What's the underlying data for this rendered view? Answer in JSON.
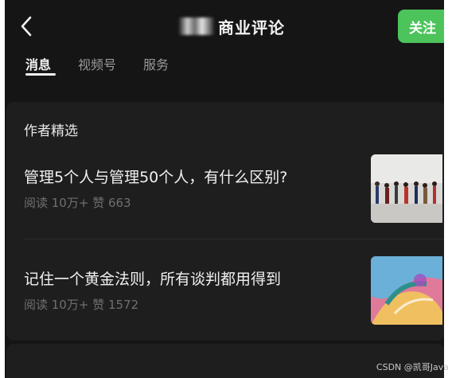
{
  "header": {
    "back_icon": "chevron-left-icon",
    "title": "商业评论",
    "follow_label": "关注",
    "follow_color": "#4cc35b"
  },
  "tabs": [
    {
      "label": "消息",
      "active": true
    },
    {
      "label": "视频号",
      "active": false
    },
    {
      "label": "服务",
      "active": false
    }
  ],
  "section": {
    "title": "作者精选",
    "articles": [
      {
        "title": "管理5个人与管理50个人，有什么区别?",
        "meta": "阅读 10万+  赞 663",
        "thumb": "people-walking-photo"
      },
      {
        "title": "记住一个黄金法则，所有谈判都用得到",
        "meta": "阅读 10万+  赞 1572",
        "thumb": "abstract-art-photo"
      }
    ]
  },
  "watermark": "CSDN @凯哥Java"
}
